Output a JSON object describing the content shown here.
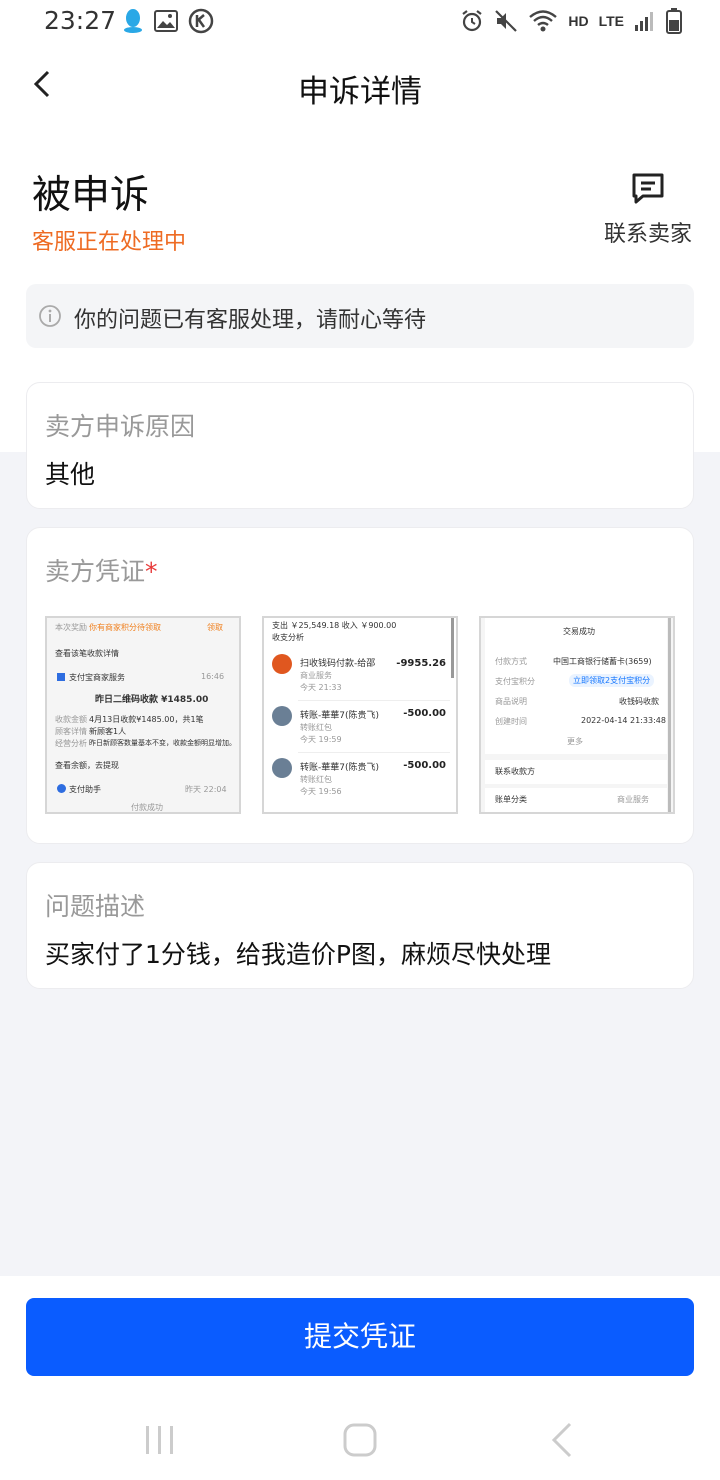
{
  "status_bar": {
    "time": "23:27",
    "left_icons": [
      "qq-icon",
      "image-icon",
      "k-icon"
    ],
    "right_icons": [
      "alarm-icon",
      "mute-icon",
      "wifi-icon",
      "signal-icon",
      "battery-icon"
    ],
    "hd": "HD",
    "lte": "LTE"
  },
  "nav": {
    "title": "申诉详情",
    "back_icon": "chevron-left-icon"
  },
  "status": {
    "title": "被申诉",
    "subtitle": "客服正在处理中",
    "contact_label": "联系卖家",
    "contact_icon": "message-icon"
  },
  "notice": {
    "icon": "info-icon",
    "text": "你的问题已有客服处理，请耐心等待"
  },
  "reason_card": {
    "label": "卖方申诉原因",
    "value": "其他"
  },
  "evidence_card": {
    "label": "卖方凭证",
    "required_mark": "*",
    "thumbs": [
      {
        "rows": {
          "r1a": "本次奖励",
          "r1b": "你有商家积分待领取",
          "r1c": "领取",
          "r2": "查看该笔收款详情",
          "r3a": "支付宝商家服务",
          "r3b": "16:46",
          "r4": "昨日二维码收款 ¥1485.00",
          "r5a": "收款金额",
          "r5b": "4月13日收款¥1485.00，共1笔",
          "r6a": "顾客详情",
          "r6b": "新顾客1人",
          "r7a": "经营分析",
          "r7b": "昨日新顾客数量基本不变，收款金额明显增加。",
          "r8": "查看余额，去提现",
          "r9a": "支付助手",
          "r9b": "昨天 22:04",
          "r10": "付款成功"
        }
      },
      {
        "rows": {
          "h1": "支出 ￥25,549.18   收入 ￥900.00",
          "h2": "收支分析",
          "i1_name": "扫收钱码付款-给邵",
          "i1_sub": "商业服务",
          "i1_time": "今天  21:33",
          "i1_amt": "-9955.26",
          "i2_name": "转账-華華7(陈贵飞)",
          "i2_sub": "转账红包",
          "i2_time": "今天  19:59",
          "i2_amt": "-500.00",
          "i3_name": "转账-華華7(陈贵飞)",
          "i3_sub": "转账红包",
          "i3_time": "今天  19:56",
          "i3_amt": "-500.00"
        }
      },
      {
        "rows": {
          "title": "交易成功",
          "k1": "付款方式",
          "v1": "中国工商银行储蓄卡(3659)",
          "k2": "支付宝积分",
          "v2": "立即领取2支付宝积分",
          "k3": "商品说明",
          "v3": "收钱码收款",
          "k4": "创建时间",
          "v4": "2022-04-14 21:33:48",
          "more": "更多",
          "k5": "联系收款方",
          "k6": "账单分类",
          "v6": "商业服务"
        }
      }
    ]
  },
  "description_card": {
    "label": "问题描述",
    "value": "买家付了1分钱，给我造价P图，麻烦尽快处理"
  },
  "submit": {
    "label": "提交凭证"
  },
  "system_nav": [
    "recents-icon",
    "home-icon",
    "back-icon"
  ],
  "colors": {
    "accent_blue": "#0a5cff",
    "status_orange": "#ee6b23",
    "required_red": "#e83a3a"
  }
}
